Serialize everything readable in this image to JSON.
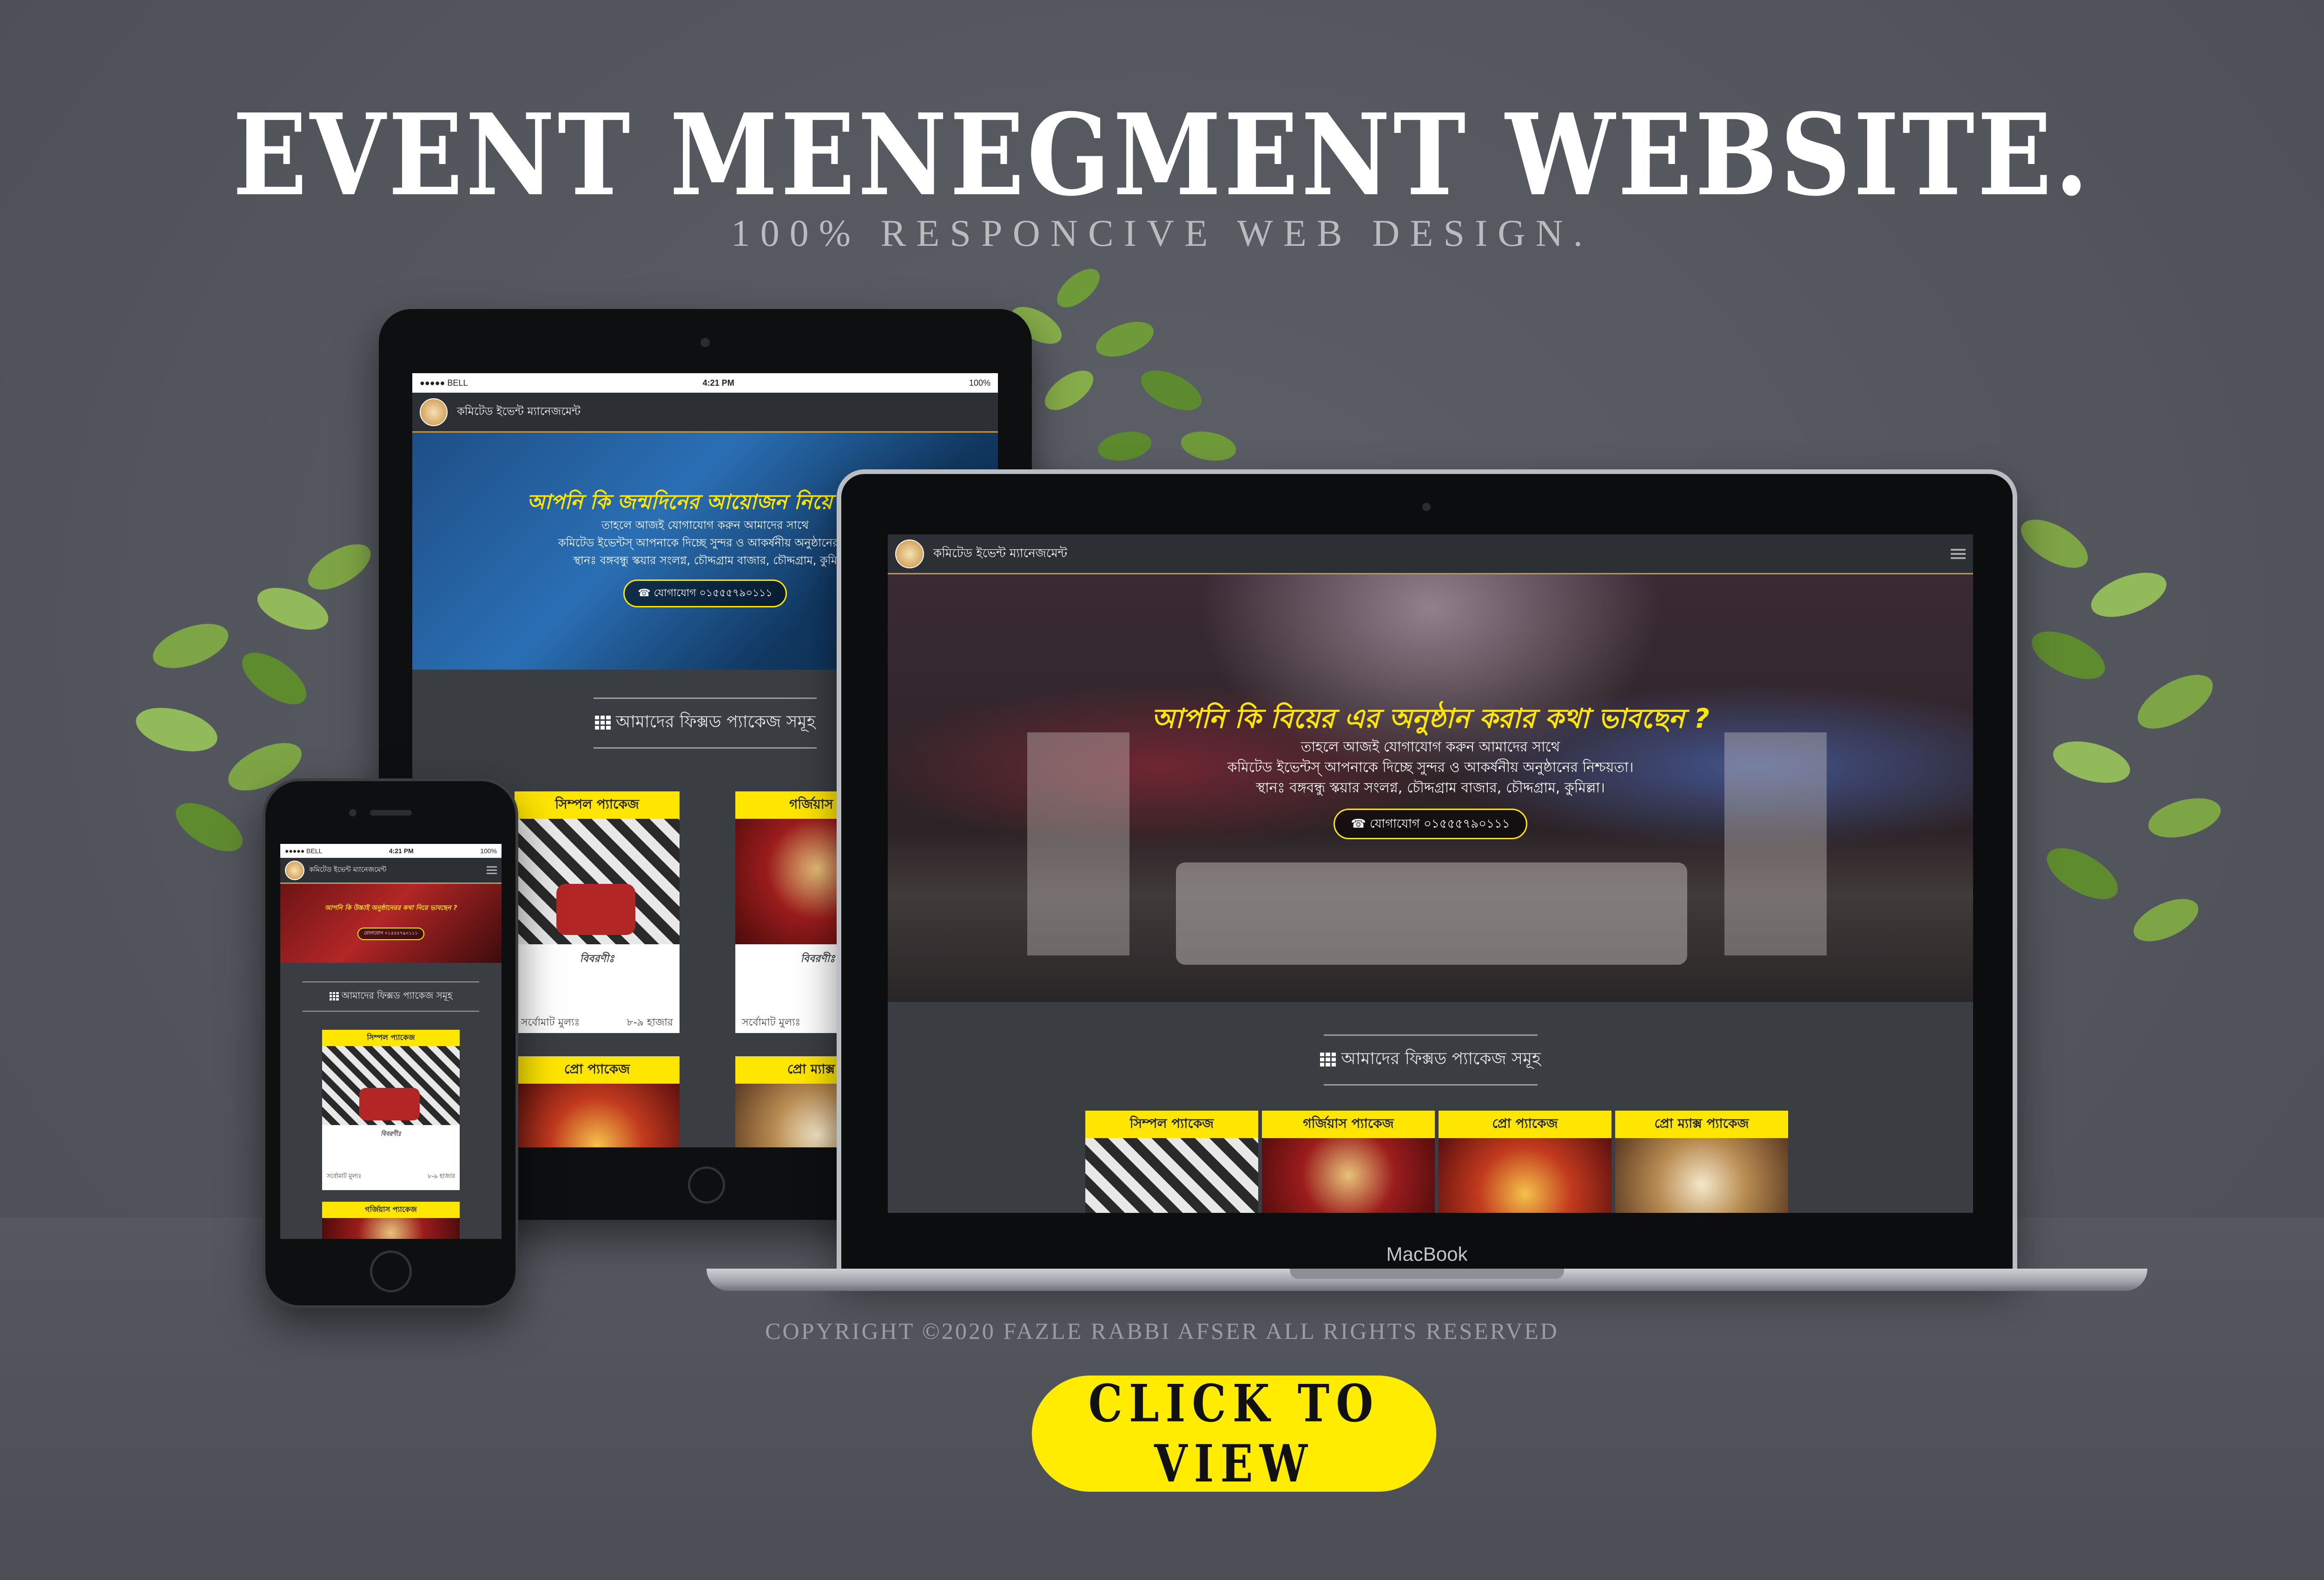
{
  "banner": {
    "headline": "EVENT MENEGMENT WEBSITE.",
    "subheadline": "100% RESPONCIVE WEB DESIGN.",
    "copyright": "COPYRIGHT ©2020 FAZLE RABBI AFSER ALL RIGHTS RESERVED",
    "cta_label": "CLICK TO VIEW",
    "laptop_brand": "MacBook"
  },
  "site": {
    "brand": "কমিটেড ইভেন্ট ম্যানেজমেন্ট",
    "section_title": "আমাদের ফিক্সড প্যাকেজ সমূহ",
    "packages": [
      "সিম্পল প্যাকেজ",
      "গর্জিয়াস প্যাকেজ",
      "প্রো প্যাকেজ",
      "প্রো ম্যাক্স প্যাকেজ"
    ],
    "package_body_label": "বিবরণীঃ",
    "price_label": "সর্বোমাট মুল্যঃ",
    "price_value": "৮-৯ হাজার"
  },
  "laptop_hero": {
    "title": "আপনি কি বিয়ের এর অনুষ্ঠান করার কথা ভাবছেন ?",
    "line1": "তাহলে আজই যোগাযোগ করুন আমাদের সাথে",
    "line2": "কমিটেড ইভেন্টস্ আপনাকে দিচ্ছে সুন্দর ও আকর্ষনীয় অনুষ্ঠানের নিশ্চয়তা।",
    "line3": "স্থানঃ বঙ্গবন্ধু স্কয়ার সংলগ্ন, চৌদ্দগ্রাম বাজার, চৌদ্দগ্রাম, কুমিল্লা।",
    "button": "যোগাযোগ ০১৫৫৫৭৯০১১১"
  },
  "tablet": {
    "status_left": "●●●●● BELL",
    "status_time": "4:21 PM",
    "status_right": "100%",
    "hero_title": "আপনি কি জন্মদিনের আয়োজন নিয়ে টেনশ",
    "line1": "তাহলে আজই যোগাযোগ করুন আমাদের সাথে",
    "line2": "কমিটেড ইভেন্টস্ আপনাকে দিচ্ছে সুন্দর ও আকর্ষনীয় অনুষ্ঠানের নি",
    "line3": "স্থানঃ বঙ্গবন্ধু স্কয়ার সংলগ্ন, চৌদ্দগ্রাম বাজার, চৌদ্দগ্রাম, কুমি",
    "button": "যোগাযোগ ০১৫৫৫৭৯০১১১",
    "pkg_gorgeous_cut": "গর্জিয়াস প",
    "pkg_promax_cut": "প্রো ম্যাক্স প"
  },
  "phone": {
    "status_left": "●●●●● BELL",
    "status_time": "4:21 PM",
    "status_right": "100%",
    "hero_title": "আপনি কি উচ্চাই অনুষ্ঠানেরর কথা নিয়ে ভাবছেন ?",
    "button": "যোগাযোগ ০১৫৫৫৭৯০১১১"
  }
}
